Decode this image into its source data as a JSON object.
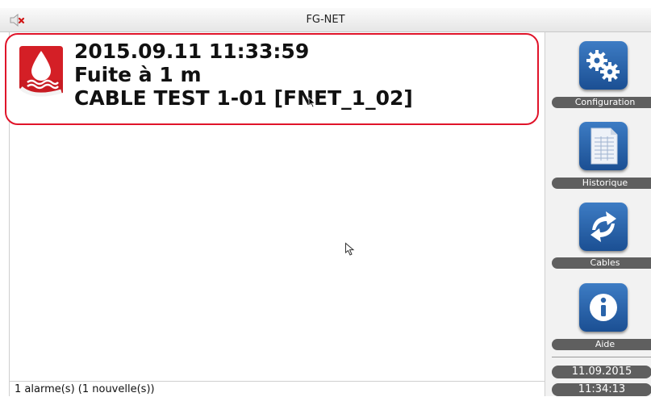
{
  "window": {
    "title": "FG-NET"
  },
  "alarm": {
    "datetime": "2015.09.11 11:33:59",
    "message": "Fuite à 1 m",
    "source": "CABLE TEST 1-01 [FNET_1_02]"
  },
  "status": {
    "text": "1 alarme(s) (1 nouvelle(s))"
  },
  "sidebar": {
    "items": [
      {
        "label": "Configuration",
        "icon": "gears-icon"
      },
      {
        "label": "Historique",
        "icon": "document-icon"
      },
      {
        "label": "Cables",
        "icon": "sync-arrows-icon"
      },
      {
        "label": "Aide",
        "icon": "info-icon"
      }
    ],
    "date": "11.09.2015",
    "time": "11:34:13"
  },
  "colors": {
    "alarm_border": "#e0142a",
    "button_blue": "#2a64aa",
    "label_bg": "#5f5f5f"
  }
}
